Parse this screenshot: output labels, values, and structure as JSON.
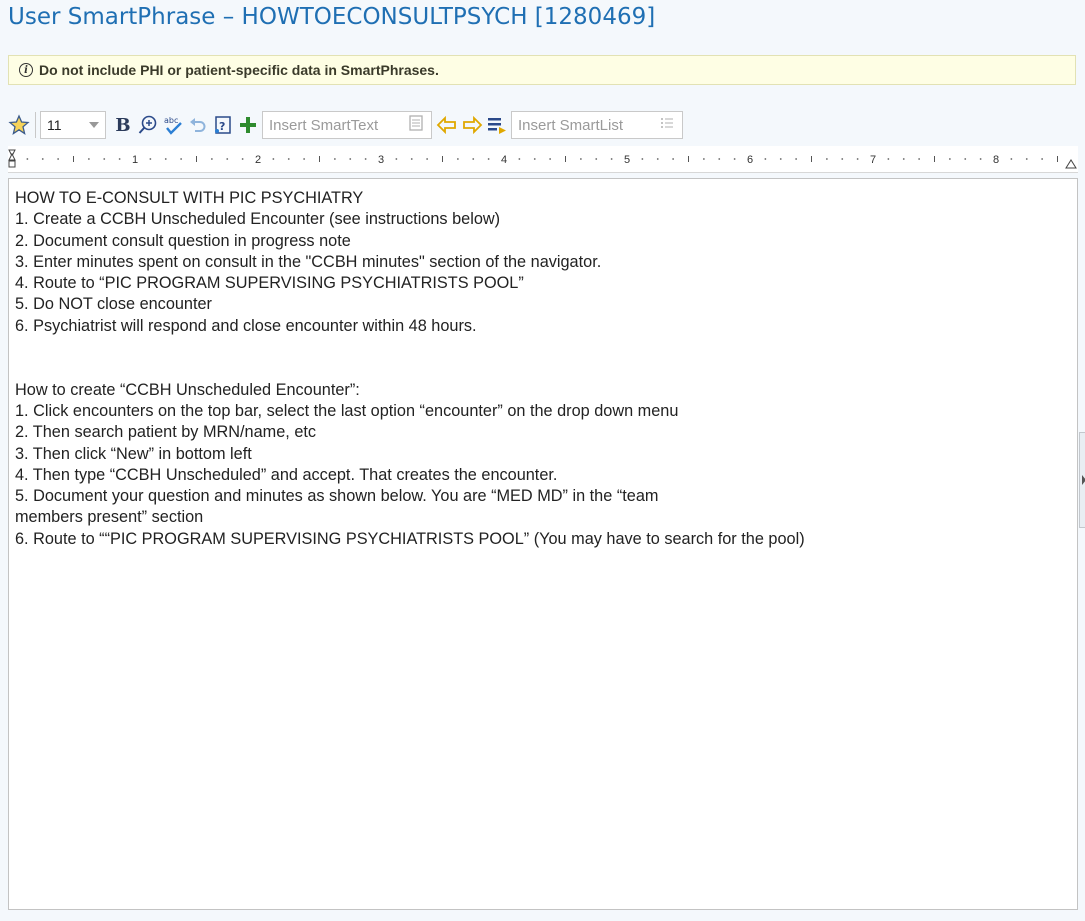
{
  "window": {
    "title": "User SmartPhrase – HOWTOECONSULTPSYCH [1280469]"
  },
  "banner": {
    "icon": "info-icon",
    "text": "Do not include PHI or patient-specific data in SmartPhrases."
  },
  "toolbar": {
    "font_size": "11",
    "insert_smarttext_placeholder": "Insert SmartText",
    "insert_smartlist_placeholder": "Insert SmartList",
    "icons": [
      "star-icon",
      "bold-icon",
      "zoom-icon",
      "spellcheck-icon",
      "undo-icon",
      "smartlink-icon",
      "add-icon",
      "copy-icon",
      "prev-icon",
      "next-icon",
      "list-format-icon",
      "list-icon"
    ]
  },
  "ruler": {
    "numbers": [
      "1",
      "2",
      "3",
      "4",
      "5",
      "6",
      "7",
      "8"
    ]
  },
  "editor": {
    "lines": [
      "HOW TO E-CONSULT WITH PIC PSYCHIATRY",
      "1. Create a CCBH Unscheduled Encounter (see instructions below)",
      "2. Document consult question in progress note",
      "3. Enter minutes spent on consult in the \"CCBH minutes\" section of the navigator.",
      "4. Route to “PIC PROGRAM SUPERVISING PSYCHIATRISTS POOL”",
      "5. Do NOT close encounter",
      "6. Psychiatrist will respond and close encounter within 48 hours.",
      "",
      "",
      "How to create “CCBH Unscheduled Encounter”:",
      "1. Click encounters on the top bar, select the last option “encounter” on the drop down menu",
      "2. Then search patient by MRN/name, etc",
      "3. Then click “New” in bottom left",
      "4. Then type “CCBH Unscheduled” and accept. That creates the encounter.",
      "5. Document your question and minutes as shown below. You are “MED MD” in the “team",
      "members present” section",
      "6. Route to ““PIC PROGRAM SUPERVISING PSYCHIATRISTS POOL” (You may have to search for the pool)"
    ]
  },
  "colors": {
    "title": "#1f6fb3",
    "banner_bg": "#fefee4",
    "add_green": "#2e8b2e",
    "arrow_yellow": "#e0a800"
  }
}
